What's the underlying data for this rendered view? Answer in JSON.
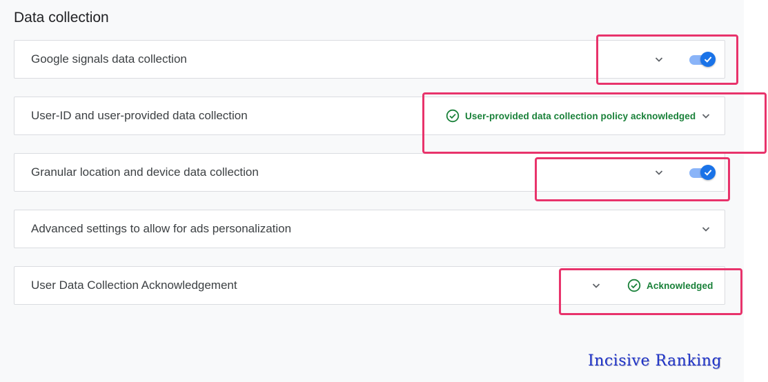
{
  "section": {
    "title": "Data collection"
  },
  "colors": {
    "toggle_on_knob": "#1a73e8",
    "toggle_on_track": "#8ab4f8",
    "status_green": "#188038",
    "highlight": "#e8336b",
    "watermark": "#1f34c9"
  },
  "rows": [
    {
      "label": "Google signals data collection",
      "expanded": false,
      "toggle_on": true
    },
    {
      "label": "User-ID and user-provided data collection",
      "expanded": false,
      "status": "User-provided data collection policy acknowledged",
      "status_icon": "check-circle-icon"
    },
    {
      "label": "Granular location and device data collection",
      "expanded": false,
      "toggle_on": true
    },
    {
      "label": "Advanced settings to allow for ads personalization",
      "expanded": false
    },
    {
      "label": "User Data Collection Acknowledgement",
      "expanded": false,
      "status": "Acknowledged",
      "status_icon": "check-circle-icon"
    }
  ],
  "watermark": {
    "text": "Incisive Ranking"
  }
}
